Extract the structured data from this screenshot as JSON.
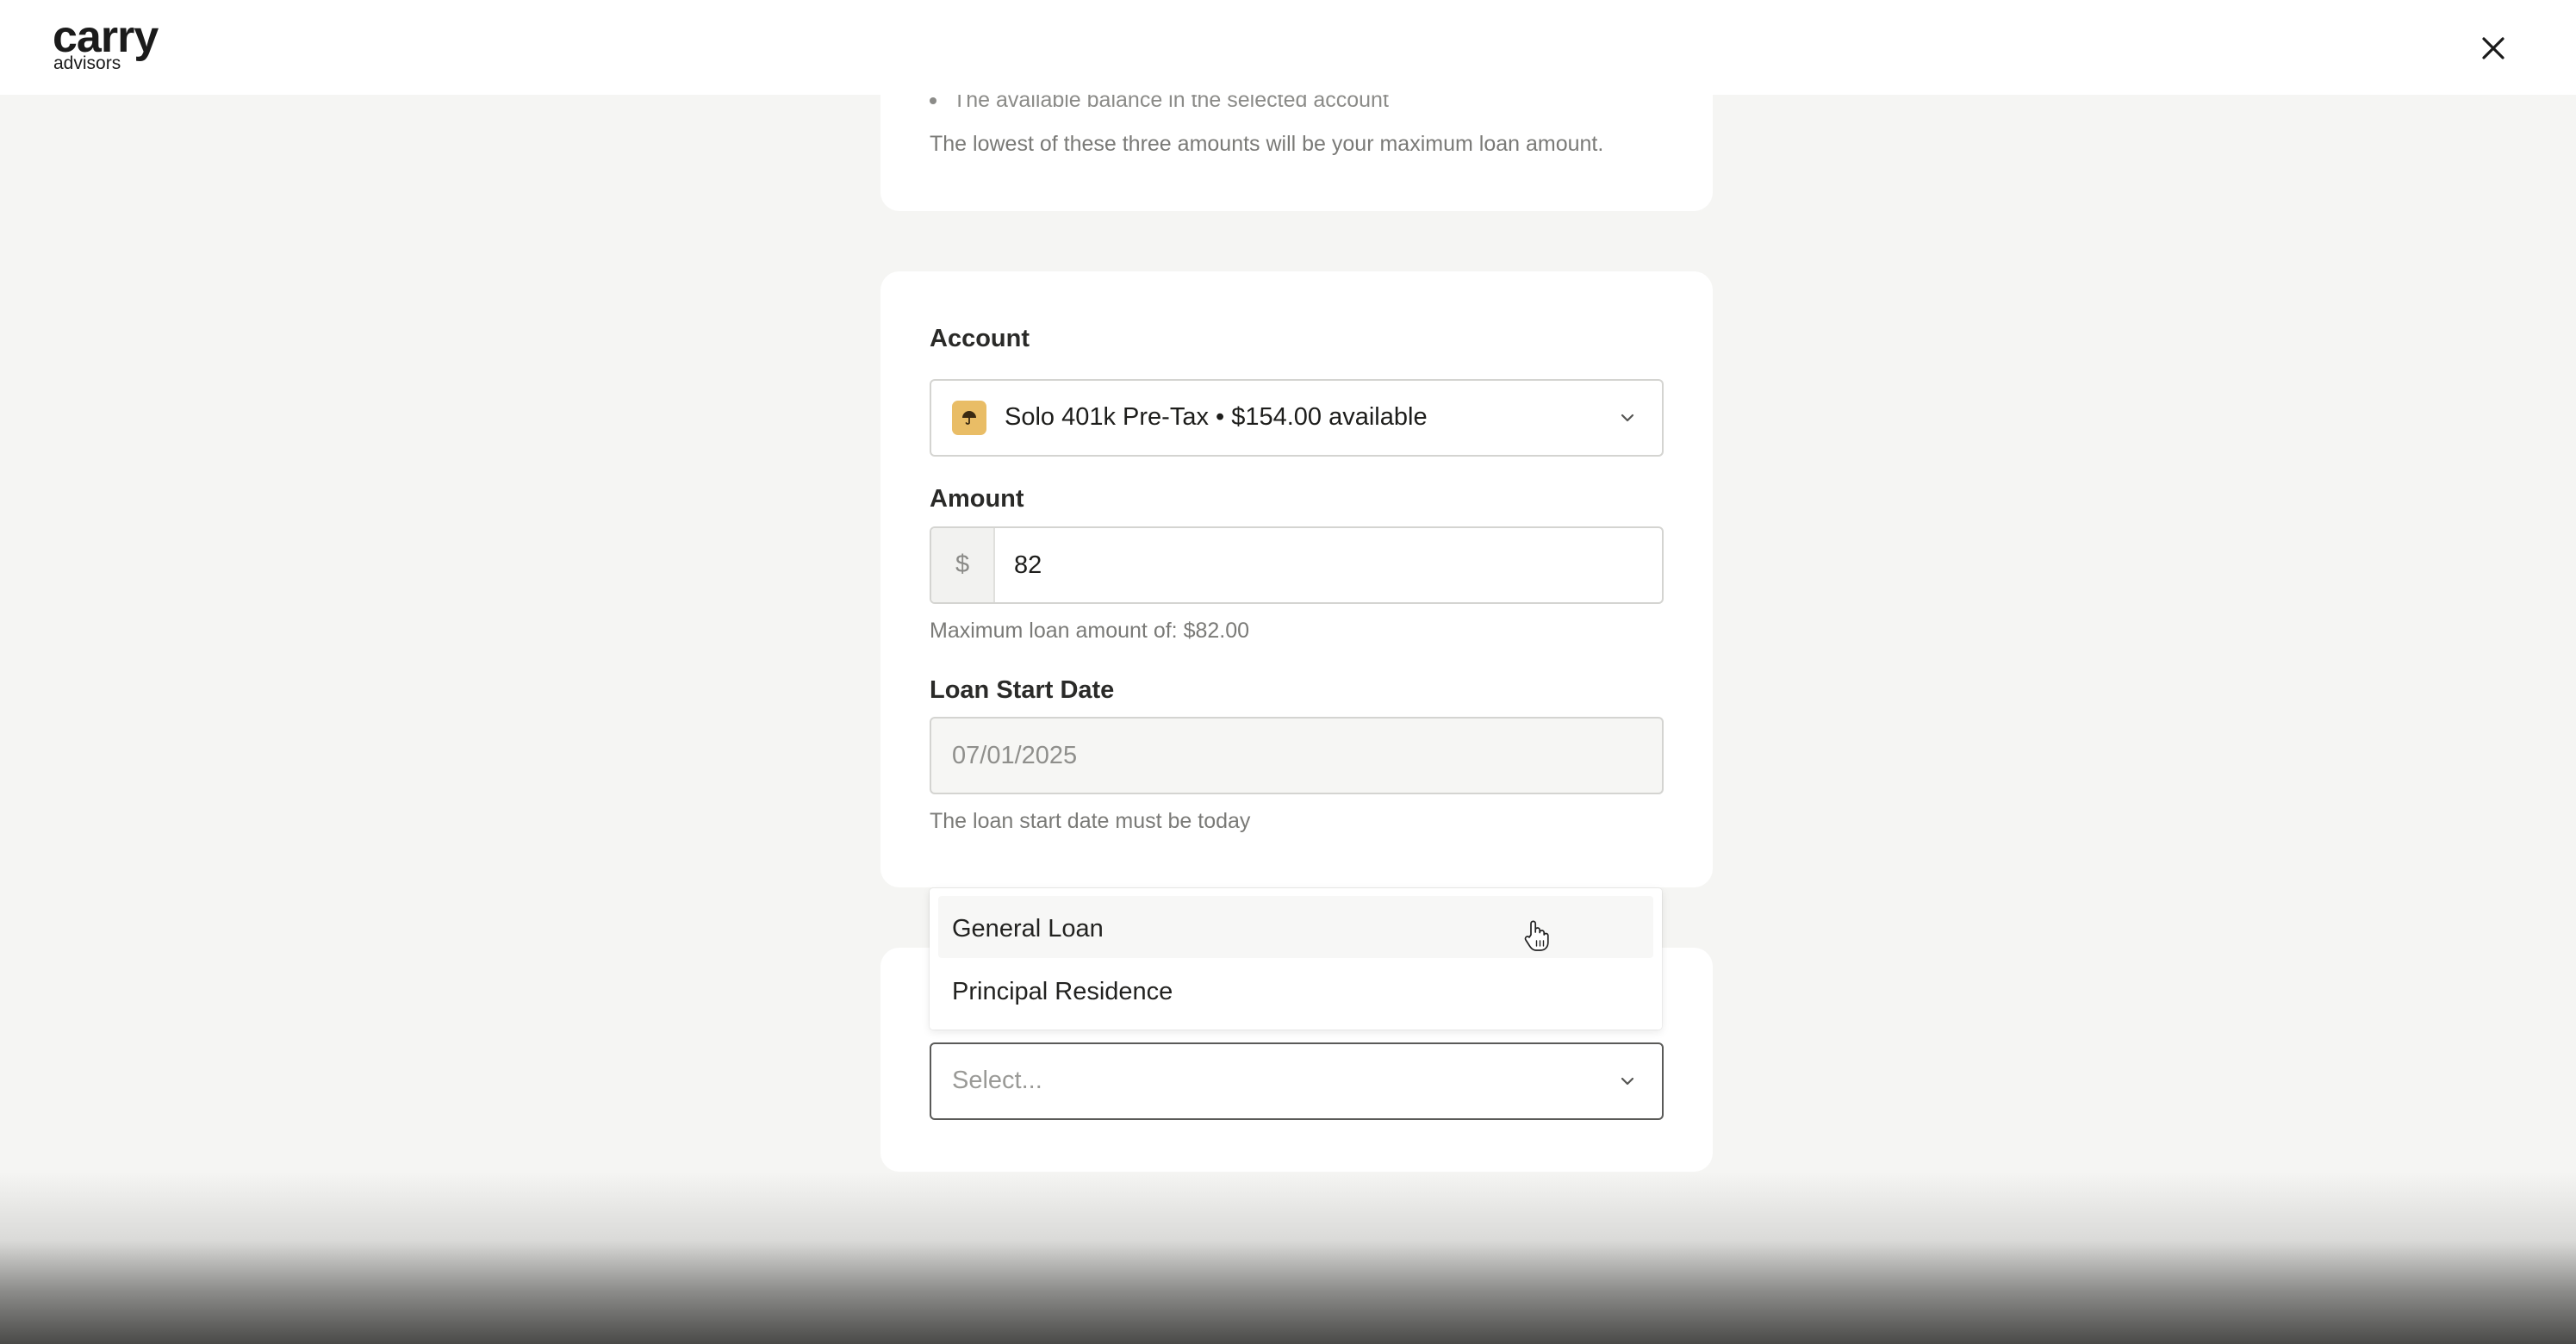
{
  "header": {
    "logo_main": "carry",
    "logo_sub": "advisors"
  },
  "info": {
    "bullet": "The available balance in the selected account",
    "note": "The lowest of these three amounts will be your maximum loan amount."
  },
  "account": {
    "label": "Account",
    "value": "Solo 401k Pre-Tax • $154.00 available",
    "icon": "umbrella-icon",
    "icon_color": "#e9bd66"
  },
  "amount": {
    "label": "Amount",
    "prefix": "$",
    "value": "82",
    "helper": "Maximum loan amount of: $82.00"
  },
  "loan_start": {
    "label": "Loan Start Date",
    "value": "07/01/2025",
    "helper": "The loan start date must be today"
  },
  "loan_type": {
    "placeholder": "Select...",
    "options": [
      "General Loan",
      "Principal Residence"
    ]
  }
}
